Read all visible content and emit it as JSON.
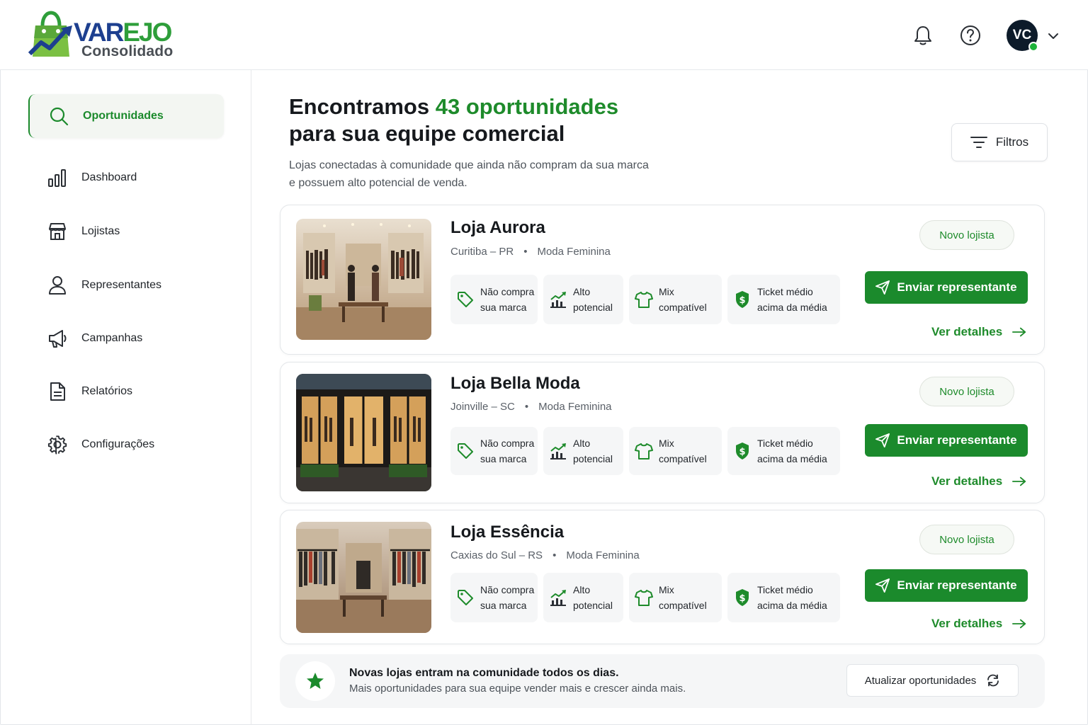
{
  "brand": {
    "name_part1": "VAR",
    "name_part2": "EJO",
    "tagline": "Consolidado"
  },
  "header": {
    "user_initials": "VC"
  },
  "sidebar": {
    "items": [
      {
        "label": "Oportunidades",
        "icon": "search-icon",
        "active": true
      },
      {
        "label": "Dashboard",
        "icon": "bar-chart-icon",
        "active": false
      },
      {
        "label": "Lojistas",
        "icon": "store-icon",
        "active": false
      },
      {
        "label": "Representantes",
        "icon": "user-icon",
        "active": false
      },
      {
        "label": "Campanhas",
        "icon": "megaphone-icon",
        "active": false
      },
      {
        "label": "Relatórios",
        "icon": "document-icon",
        "active": false
      },
      {
        "label": "Configurações",
        "icon": "gear-icon",
        "active": false
      }
    ]
  },
  "main": {
    "title_prefix": "Encontramos ",
    "title_highlight": "43 oportunidades",
    "title_line2": "para sua equipe comercial",
    "subtitle_line1": "Lojas conectadas à comunidade que ainda não compram da sua marca",
    "subtitle_line2": "e possuem alto potencial de venda.",
    "filters_label": "Filtros"
  },
  "stores": [
    {
      "name": "Loja Aurora",
      "city": "Curitiba – PR",
      "segment": "Moda Feminina",
      "badge": "Novo lojista",
      "send_label": "Enviar representante",
      "details_label": "Ver detalhes"
    },
    {
      "name": "Loja Bella Moda",
      "city": "Joinville – SC",
      "segment": "Moda Feminina",
      "badge": "Novo lojista",
      "send_label": "Enviar representante",
      "details_label": "Ver detalhes"
    },
    {
      "name": "Loja Essência",
      "city": "Caxias do Sul – RS",
      "segment": "Moda Feminina",
      "badge": "Novo lojista",
      "send_label": "Enviar representante",
      "details_label": "Ver detalhes"
    }
  ],
  "chips": [
    {
      "line1": "Não compra",
      "line2": "sua marca",
      "icon": "tag-icon"
    },
    {
      "line1": "Alto",
      "line2": "potencial",
      "icon": "growth-chart-icon"
    },
    {
      "line1": "Mix",
      "line2": "compatível",
      "icon": "tshirt-icon"
    },
    {
      "line1": "Ticket médio",
      "line2": "acima da média",
      "icon": "dollar-icon"
    }
  ],
  "banner": {
    "title": "Novas lojas entram na comunidade todos os dias.",
    "subtitle": "Mais oportunidades para sua equipe vender mais e crescer ainda mais.",
    "button_label": "Atualizar oportunidades"
  },
  "colors": {
    "accent": "#1b8a2c",
    "brand_blue": "#1d3f8f",
    "brand_green": "#2e9e3a",
    "status_online": "#1db33a"
  }
}
